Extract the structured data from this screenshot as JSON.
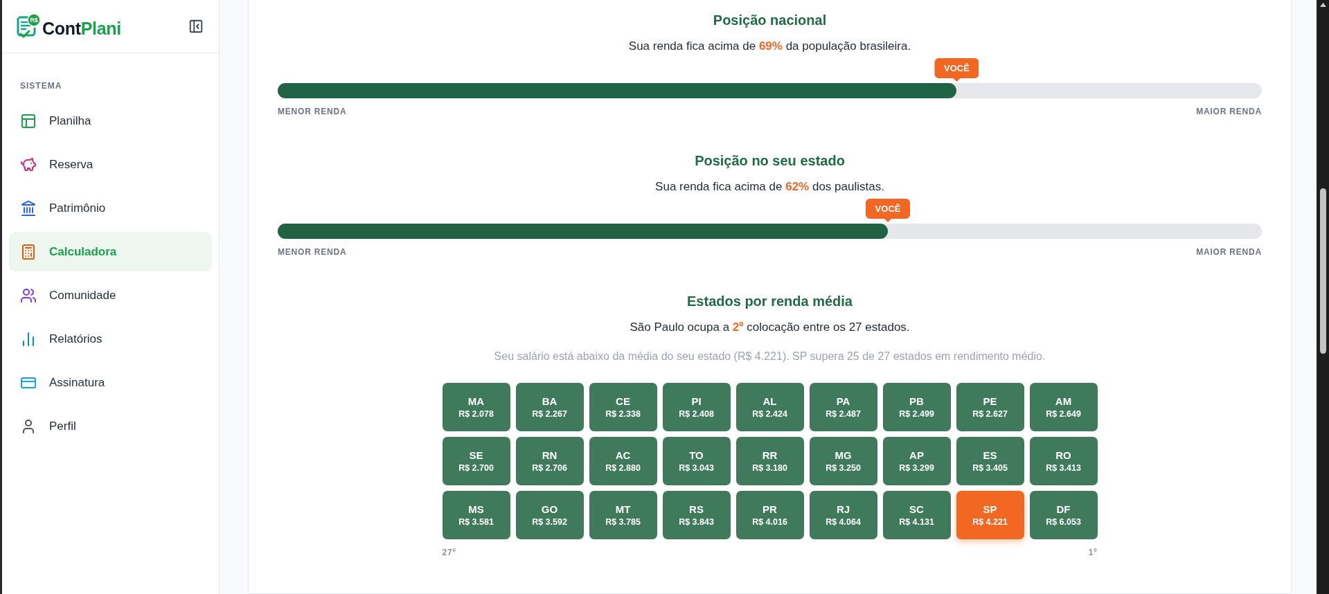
{
  "sidebar": {
    "logo": {
      "badge": "R$",
      "name_parts": [
        {
          "text": "Cont",
          "kind": "plain"
        },
        {
          "text": "Plani",
          "kind": "accent"
        }
      ]
    },
    "section_label": "SISTEMA",
    "items": [
      {
        "label": "Planilha",
        "selected": false
      },
      {
        "label": "Reserva",
        "selected": false
      },
      {
        "label": "Patrimônio",
        "selected": false
      },
      {
        "label": "Calculadora",
        "selected": true
      },
      {
        "label": "Comunidade",
        "selected": false
      },
      {
        "label": "Relatórios",
        "selected": false
      },
      {
        "label": "Assinatura",
        "selected": false
      },
      {
        "label": "Perfil",
        "selected": false
      }
    ]
  },
  "main": {
    "sections": [
      {
        "kind": "position",
        "title": "Posição nacional",
        "text": "Sua renda fica acima de **69%** da população brasileira.",
        "marker": "VOCÊ",
        "level": 0.69,
        "scale_labels": [
          "MENOR RENDA",
          "MAIOR RENDA"
        ]
      },
      {
        "kind": "position",
        "title": "Posição no seu estado",
        "text": "Sua renda fica acima de **62%** dos paulistas.",
        "marker": "VOCÊ",
        "level": 0.62,
        "scale_labels": [
          "MENOR RENDA",
          "MAIOR RENDA"
        ]
      },
      {
        "kind": "ranking",
        "title": "Estados por renda média",
        "text": "São Paulo ocupa a **2º** colocação entre os 27 estados.",
        "note": "Seu salário está abaixo da média do seu estado (R$ 4.221). SP supera 25 de 27 estados em rendimento médio.",
        "states": [
          {
            "code": "MA",
            "value": "R$ 2.078",
            "selected": false
          },
          {
            "code": "BA",
            "value": "R$ 2.267",
            "selected": false
          },
          {
            "code": "CE",
            "value": "R$ 2.338",
            "selected": false
          },
          {
            "code": "PI",
            "value": "R$ 2.408",
            "selected": false
          },
          {
            "code": "AL",
            "value": "R$ 2.424",
            "selected": false
          },
          {
            "code": "PA",
            "value": "R$ 2.487",
            "selected": false
          },
          {
            "code": "PB",
            "value": "R$ 2.499",
            "selected": false
          },
          {
            "code": "PE",
            "value": "R$ 2.627",
            "selected": false
          },
          {
            "code": "AM",
            "value": "R$ 2.649",
            "selected": false
          },
          {
            "code": "SE",
            "value": "R$ 2.700",
            "selected": false
          },
          {
            "code": "RN",
            "value": "R$ 2.706",
            "selected": false
          },
          {
            "code": "AC",
            "value": "R$ 2.880",
            "selected": false
          },
          {
            "code": "TO",
            "value": "R$ 3.043",
            "selected": false
          },
          {
            "code": "RR",
            "value": "R$ 3.180",
            "selected": false
          },
          {
            "code": "MG",
            "value": "R$ 3.250",
            "selected": false
          },
          {
            "code": "AP",
            "value": "R$ 3.299",
            "selected": false
          },
          {
            "code": "ES",
            "value": "R$ 3.405",
            "selected": false
          },
          {
            "code": "RO",
            "value": "R$ 3.413",
            "selected": false
          },
          {
            "code": "MS",
            "value": "R$ 3.581",
            "selected": false
          },
          {
            "code": "GO",
            "value": "R$ 3.592",
            "selected": false
          },
          {
            "code": "MT",
            "value": "R$ 3.785",
            "selected": false
          },
          {
            "code": "RS",
            "value": "R$ 3.843",
            "selected": false
          },
          {
            "code": "PR",
            "value": "R$ 4.016",
            "selected": false
          },
          {
            "code": "RJ",
            "value": "R$ 4.064",
            "selected": false
          },
          {
            "code": "SC",
            "value": "R$ 4.131",
            "selected": false
          },
          {
            "code": "SP",
            "value": "R$ 4.221",
            "selected": true
          },
          {
            "code": "DF",
            "value": "R$ 6.053",
            "selected": false
          }
        ],
        "scale_labels": [
          "27º",
          "1º"
        ]
      }
    ]
  }
}
